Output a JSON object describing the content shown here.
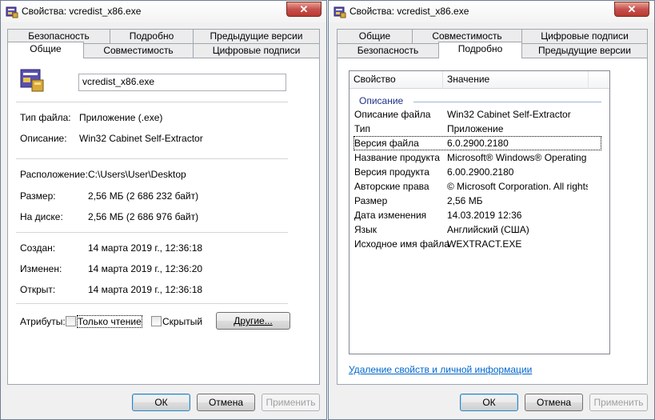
{
  "left": {
    "title": "Свойства: vcredist_x86.exe",
    "close_glyph": "✕",
    "tabs_back": [
      "Безопасность",
      "Подробно",
      "Предыдущие версии"
    ],
    "tabs_front": [
      "Общие",
      "Совместимость",
      "Цифровые подписи"
    ],
    "filename": "vcredist_x86.exe",
    "type_label": "Тип файла:",
    "type_value": "Приложение (.exe)",
    "desc_label": "Описание:",
    "desc_value": "Win32 Cabinet Self-Extractor",
    "location_label": "Расположение:",
    "location_value": "C:\\Users\\User\\Desktop",
    "size_label": "Размер:",
    "size_value": "2,56 МБ (2 686 232 байт)",
    "ondisk_label": "На диске:",
    "ondisk_value": "2,56 МБ (2 686 976 байт)",
    "created_label": "Создан:",
    "created_value": "14 марта 2019 г., 12:36:18",
    "modified_label": "Изменен:",
    "modified_value": "14 марта 2019 г., 12:36:20",
    "accessed_label": "Открыт:",
    "accessed_value": "14 марта 2019 г., 12:36:18",
    "attributes_label": "Атрибуты:",
    "readonly_label": "Только чтение",
    "hidden_label": "Скрытый",
    "other_button": "Другие...",
    "ok": "ОК",
    "cancel": "Отмена",
    "apply": "Применить"
  },
  "right": {
    "title": "Свойства: vcredist_x86.exe",
    "close_glyph": "✕",
    "tabs_back": [
      "Общие",
      "Совместимость",
      "Цифровые подписи"
    ],
    "tabs_front": [
      "Безопасность",
      "Подробно",
      "Предыдущие версии"
    ],
    "col_property": "Свойство",
    "col_value": "Значение",
    "group": "Описание",
    "rows": [
      {
        "k": "Описание файла",
        "v": "Win32 Cabinet Self-Extractor"
      },
      {
        "k": "Тип",
        "v": "Приложение"
      },
      {
        "k": "Версия файла",
        "v": "6.0.2900.2180"
      },
      {
        "k": "Название продукта",
        "v": "Microsoft® Windows® Operating ..."
      },
      {
        "k": "Версия продукта",
        "v": "6.00.2900.2180"
      },
      {
        "k": "Авторские права",
        "v": "© Microsoft Corporation. All rights ..."
      },
      {
        "k": "Размер",
        "v": "2,56 МБ"
      },
      {
        "k": "Дата изменения",
        "v": "14.03.2019 12:36"
      },
      {
        "k": "Язык",
        "v": "Английский (США)"
      },
      {
        "k": "Исходное имя файла",
        "v": "WEXTRACT.EXE"
      }
    ],
    "remove_link": "Удаление свойств и личной информации",
    "ok": "ОК",
    "cancel": "Отмена",
    "apply": "Применить"
  },
  "icons": {
    "title": "installer-icon",
    "file": "installer-icon",
    "close": "close-icon"
  },
  "colors": {
    "close_button": "#c75050",
    "link": "#0066cc",
    "group_header": "#1e3287"
  }
}
